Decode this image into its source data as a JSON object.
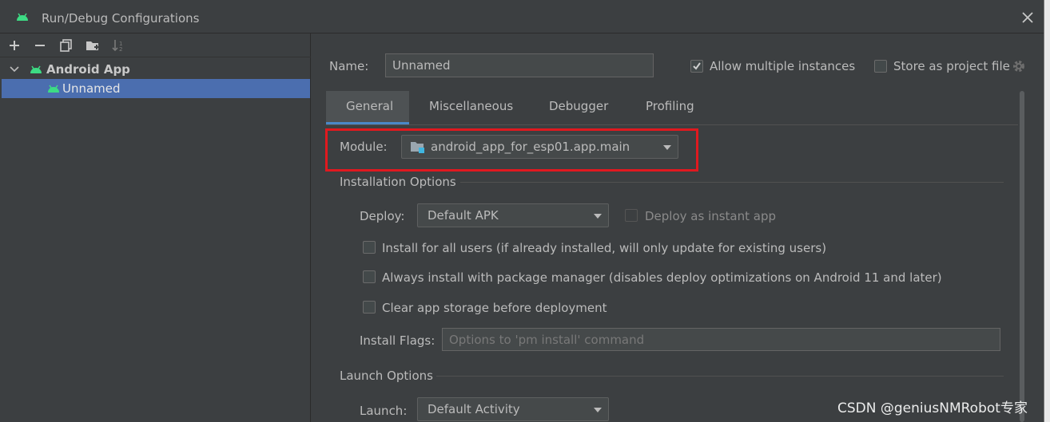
{
  "window": {
    "title": "Run/Debug Configurations"
  },
  "tree": {
    "root_label": "Android App",
    "child_label": "Unnamed"
  },
  "form": {
    "name_label": "Name:",
    "name_value": "Unnamed",
    "allow_multiple_label": "Allow multiple instances",
    "allow_multiple_checked": true,
    "store_project_label": "Store as project file",
    "store_project_checked": false
  },
  "tabs": [
    "General",
    "Miscellaneous",
    "Debugger",
    "Profiling"
  ],
  "selected_tab": "General",
  "module": {
    "label": "Module:",
    "value": "android_app_for_esp01.app.main"
  },
  "installation": {
    "section_title": "Installation Options",
    "deploy_label": "Deploy:",
    "deploy_value": "Default APK",
    "instant_app_label": "Deploy as instant app",
    "install_all_users_label": "Install for all users (if already installed, will only update for existing users)",
    "package_manager_label": "Always install with package manager (disables deploy optimizations on Android 11 and later)",
    "clear_storage_label": "Clear app storage before deployment",
    "install_flags_label": "Install Flags:",
    "install_flags_placeholder": "Options to 'pm install' command"
  },
  "launch": {
    "section_title": "Launch Options",
    "launch_label": "Launch:",
    "launch_value": "Default Activity"
  },
  "watermark": "CSDN @geniusNMRobot专家",
  "colors": {
    "background": "#3c3f41",
    "selection": "#4b6eaf",
    "android_green": "#3ddc84",
    "highlight_box": "#e0191f"
  }
}
